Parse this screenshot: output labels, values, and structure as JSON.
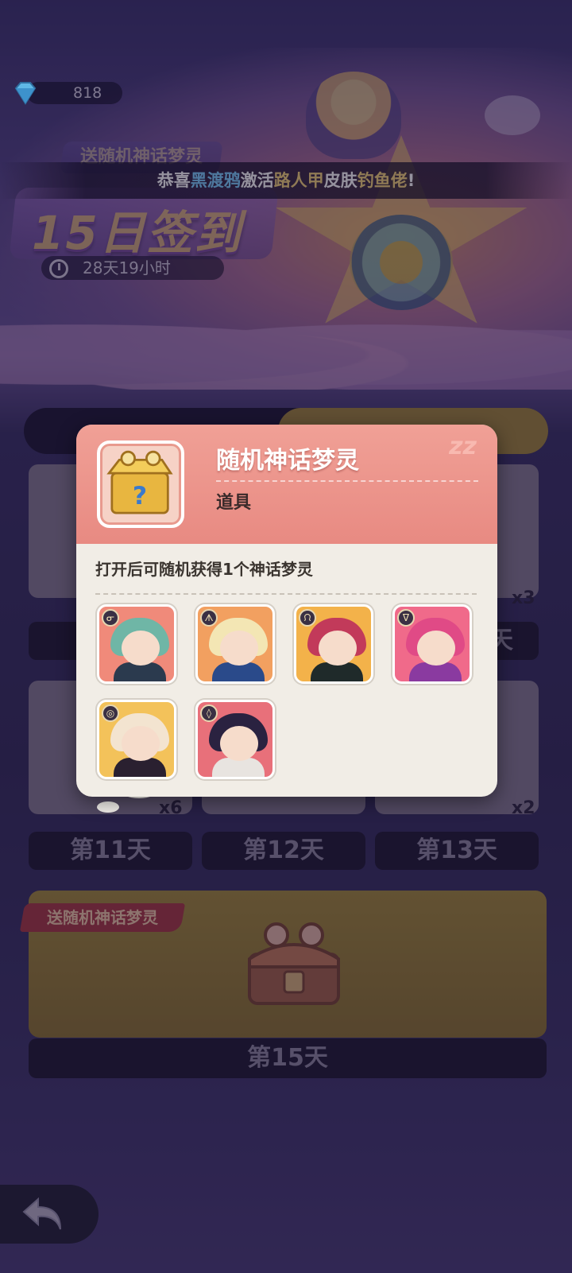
{
  "currency": {
    "gems": "818",
    "icon": "gem-icon"
  },
  "header": {
    "event_tag": "送随机神话梦灵",
    "title": "15日签到",
    "timer": "28天19小时"
  },
  "ticker": {
    "prefix": "恭喜",
    "player": "黑渡鸦",
    "mid1": "激活",
    "hero": "路人甲",
    "mid2": "皮肤",
    "skin": "钓鱼佬",
    "suffix": "!"
  },
  "days": [
    {
      "label": "第11天",
      "qty": "x6"
    },
    {
      "label": "第12天",
      "qty": ""
    },
    {
      "label": "第13天",
      "qty": "x2"
    }
  ],
  "partial_rows": {
    "row1_qty": "x3",
    "row1_label_tail": "天"
  },
  "grand_reward": {
    "tag": "送随机神话梦灵",
    "label": "第15天"
  },
  "popup": {
    "item_name": "随机神话梦灵",
    "item_type": "道具",
    "description": "打开后可随机获得1个神话梦灵",
    "characters": [
      {
        "name": "character-1",
        "badge": "ᓂ",
        "bg": "#f08a7a",
        "hair": "#6fb6a6",
        "body": "#2b3a4e"
      },
      {
        "name": "character-2",
        "badge": "ᗑ",
        "bg": "#f2a060",
        "hair": "#f3e6b4",
        "body": "#2a4a8a"
      },
      {
        "name": "character-3",
        "badge": "ᙁ",
        "bg": "#f3b24a",
        "hair": "#c23a5a",
        "body": "#1f2a2a"
      },
      {
        "name": "character-4",
        "badge": "ᐁ",
        "bg": "#f06a8a",
        "hair": "#e04a86",
        "body": "#8a3aa0"
      },
      {
        "name": "character-5",
        "badge": "◎",
        "bg": "#f3c25a",
        "hair": "#f3e4d0",
        "body": "#2a2030"
      },
      {
        "name": "character-6",
        "badge": "◊",
        "bg": "#e8707a",
        "hair": "#2a2240",
        "body": "#e8e4e0"
      }
    ]
  },
  "colors": {
    "popup_header": "#e88a82",
    "highlight_blue": "#7fd0ff",
    "highlight_yellow": "#f5d47a"
  }
}
